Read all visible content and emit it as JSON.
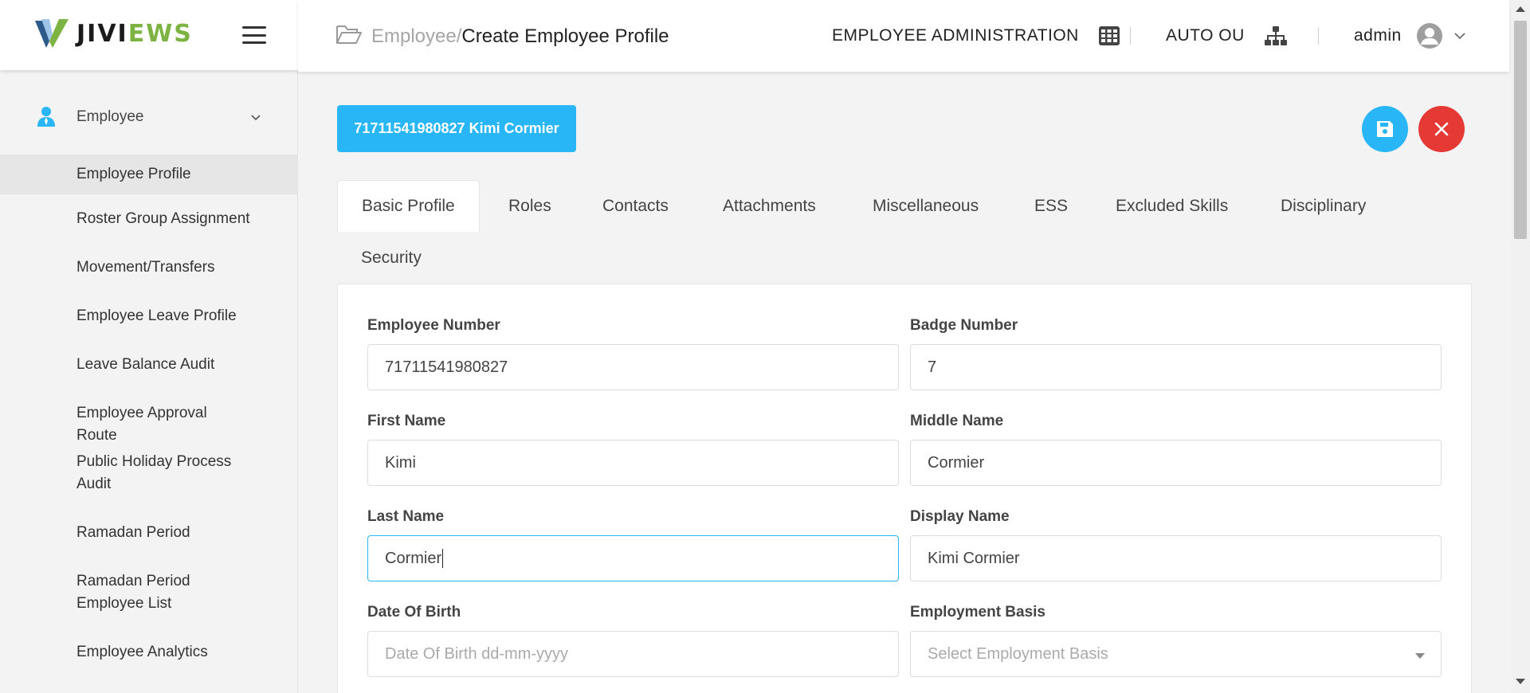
{
  "sidebar": {
    "logo": {
      "text_dark": "JIVI",
      "text_green": "EWS"
    },
    "menu_parent": {
      "label": "Employee",
      "icon": "person-icon",
      "expanded": true
    },
    "items": [
      {
        "label": "Employee Profile",
        "active": true
      },
      {
        "label": "Roster Group Assignment"
      },
      {
        "label": "Movement/Transfers"
      },
      {
        "label": "Employee Leave Profile"
      },
      {
        "label": "Leave Balance Audit"
      },
      {
        "label": "Employee Approval Route"
      },
      {
        "label": "Public Holiday Process Audit"
      },
      {
        "label": "Ramadan Period"
      },
      {
        "label": "Ramadan Period Employee List"
      },
      {
        "label": "Employee Analytics"
      }
    ]
  },
  "header": {
    "breadcrumb_parent": "Employee/",
    "breadcrumb_current": "Create Employee Profile",
    "module_label": "EMPLOYEE ADMINISTRATION",
    "org_label": "AUTO OU",
    "user_label": "admin"
  },
  "main": {
    "employee_pill": "71711541980827 Kimi Cormier",
    "tabs": [
      {
        "label": "Basic Profile",
        "active": true
      },
      {
        "label": "Roles"
      },
      {
        "label": "Contacts"
      },
      {
        "label": "Attachments"
      },
      {
        "label": "Miscellaneous"
      },
      {
        "label": "ESS"
      },
      {
        "label": "Excluded Skills"
      },
      {
        "label": "Disciplinary"
      },
      {
        "label": "Security"
      }
    ],
    "form": {
      "employee_number": {
        "label": "Employee Number",
        "value": "71711541980827"
      },
      "badge_number": {
        "label": "Badge Number",
        "value": "7"
      },
      "first_name": {
        "label": "First Name",
        "value": "Kimi"
      },
      "middle_name": {
        "label": "Middle Name",
        "value": "Cormier"
      },
      "last_name": {
        "label": "Last Name",
        "value": "Cormier"
      },
      "display_name": {
        "label": "Display Name",
        "value": "Kimi Cormier"
      },
      "date_of_birth": {
        "label": "Date Of Birth",
        "placeholder": "Date Of Birth dd-mm-yyyy"
      },
      "employment_basis": {
        "label": "Employment Basis",
        "placeholder": "Select Employment Basis"
      }
    }
  },
  "colors": {
    "accent": "#29b6f6",
    "danger": "#e53935",
    "brand_green": "#7cb342"
  }
}
